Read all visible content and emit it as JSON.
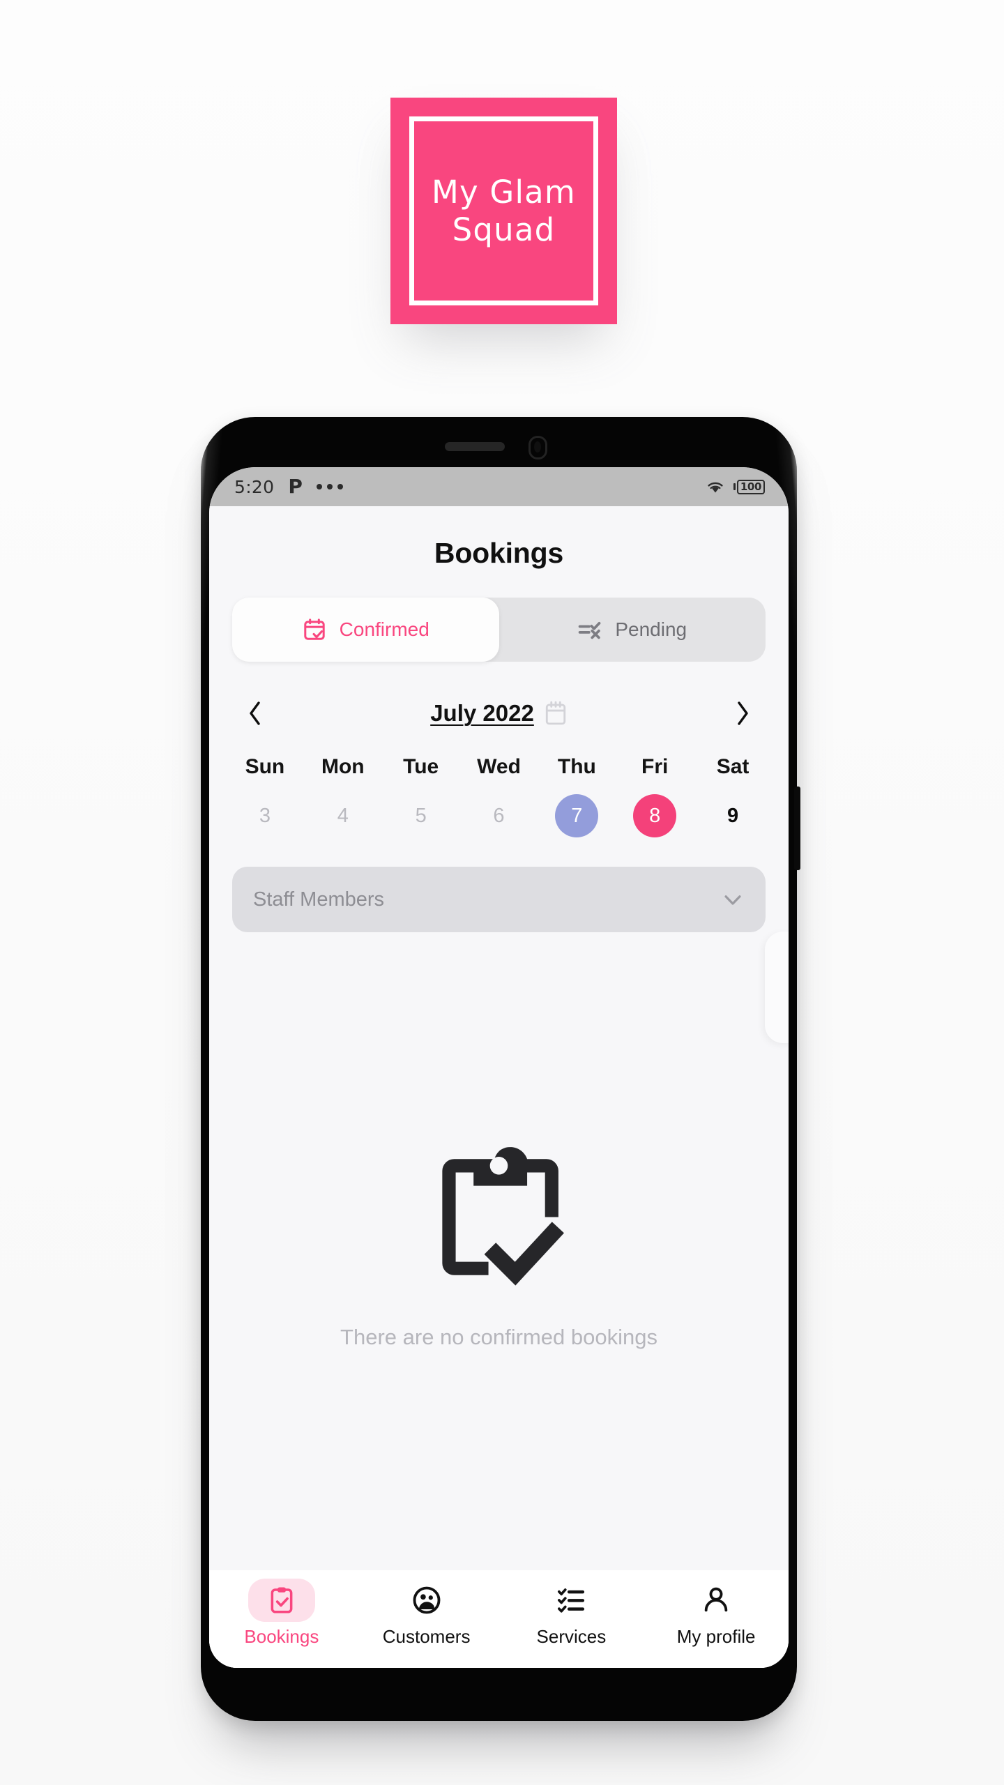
{
  "logo": {
    "name": "my-glam-squad-logo",
    "line1": "My Glam",
    "line2": "Squad",
    "background_color": "#f9467f",
    "border_color": "#ffffff"
  },
  "status_bar": {
    "time": "5:20",
    "carrier_glyph": "P",
    "notification_dots": 3,
    "wifi_icon": "wifi-icon",
    "battery_level": "100"
  },
  "screen": {
    "title": "Bookings",
    "tabs": [
      {
        "label": "Confirmed",
        "icon": "calendar-check-icon",
        "active": true
      },
      {
        "label": "Pending",
        "icon": "list-check-x-icon",
        "active": false
      }
    ],
    "calendar": {
      "prev_icon": "chevron-left-icon",
      "next_icon": "chevron-right-icon",
      "month_label": "July 2022",
      "calendar_icon": "calendar-icon",
      "day_names": [
        "Sun",
        "Mon",
        "Tue",
        "Wed",
        "Thu",
        "Fri",
        "Sat"
      ],
      "dates": [
        {
          "day": "3",
          "state": "muted"
        },
        {
          "day": "4",
          "state": "muted"
        },
        {
          "day": "5",
          "state": "muted"
        },
        {
          "day": "6",
          "state": "muted"
        },
        {
          "day": "7",
          "state": "today"
        },
        {
          "day": "8",
          "state": "selected"
        },
        {
          "day": "9",
          "state": "normal"
        }
      ],
      "today_color": "#939ddb",
      "selected_color": "#f4417a"
    },
    "staff_select": {
      "placeholder": "Staff Members",
      "value": "",
      "chevron_icon": "chevron-down-icon"
    },
    "empty_state": {
      "icon": "clipboard-check-icon",
      "message": "There are no confirmed bookings"
    },
    "bottom_nav": [
      {
        "label": "Bookings",
        "icon": "clipboard-check-icon",
        "active": true
      },
      {
        "label": "Customers",
        "icon": "customers-icon",
        "active": false
      },
      {
        "label": "Services",
        "icon": "checklist-icon",
        "active": false
      },
      {
        "label": "My profile",
        "icon": "person-icon",
        "active": false
      }
    ]
  },
  "colors": {
    "brand_pink": "#f9467f",
    "accent_pink": "#f4417a",
    "today_periwinkle": "#939ddb",
    "screen_bg": "#f7f7f9",
    "muted_text": "#b6b6bc"
  }
}
